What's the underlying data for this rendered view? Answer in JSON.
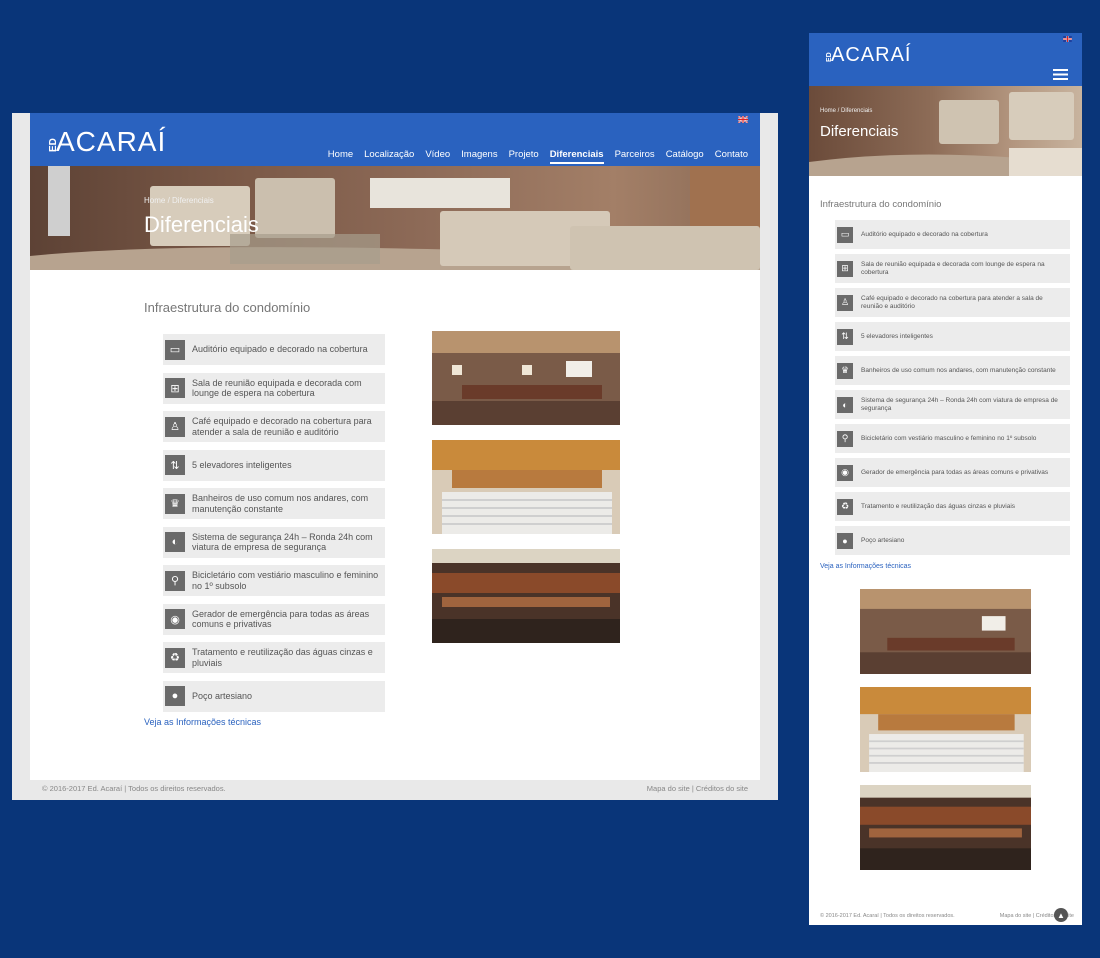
{
  "desktop": {
    "logo": {
      "prefix": "ED",
      "name": "ACARAÍ"
    },
    "nav": [
      "Home",
      "Localização",
      "Vídeo",
      "Imagens",
      "Projeto",
      "Diferenciais",
      "Parceiros",
      "Catálogo",
      "Contato"
    ],
    "active_nav": "Diferenciais",
    "breadcrumb": {
      "home": "Home",
      "current": "Diferenciais"
    },
    "hero_title": "Diferenciais",
    "section_title": "Infraestrutura do condomínio",
    "features": [
      {
        "icon": "auditorium-icon",
        "text": "Auditório equipado e decorado na cobertura"
      },
      {
        "icon": "meeting-room-icon",
        "text": "Sala de reunião equipada e decorada com lounge de espera na cobertura"
      },
      {
        "icon": "people-icon",
        "text": "Café equipado e decorado na cobertura para atender a sala de reunião e auditório"
      },
      {
        "icon": "elevator-icon",
        "text": "5 elevadores inteligentes"
      },
      {
        "icon": "restroom-icon",
        "text": "Banheiros de uso comum nos andares, com manutenção constante"
      },
      {
        "icon": "security-icon",
        "text": "Sistema de segurança 24h – Ronda 24h com viatura de empresa de segurança"
      },
      {
        "icon": "bicycle-icon",
        "text": "Bicicletário com vestiário masculino e feminino no 1º subsolo"
      },
      {
        "icon": "generator-icon",
        "text": "Gerador de emergência para todas as áreas comuns e privativas"
      },
      {
        "icon": "recycle-icon",
        "text": "Tratamento e reutilização das águas cinzas e pluviais"
      },
      {
        "icon": "water-drop-icon",
        "text": "Poço artesiano"
      }
    ],
    "more_link": "Veja as Informações técnicas",
    "footer": {
      "copyright": "© 2016-2017 Ed. Acaraí | Todos os direitos reservados.",
      "sitemap": "Mapa do site",
      "credits": "Créditos do site",
      "divider": "|"
    }
  },
  "mobile": {
    "logo": {
      "prefix": "ED",
      "name": "ACARAÍ"
    },
    "breadcrumb": {
      "home": "Home",
      "current": "Diferenciais"
    },
    "hero_title": "Diferenciais",
    "section_title": "Infraestrutura do condomínio",
    "more_link": "Veja as Informações técnicas",
    "footer": {
      "copyright": "© 2016-2017 Ed. Acaraí | Todos os direitos reservados.",
      "sitemap": "Mapa do site",
      "credits": "Créditos do site",
      "divider": "|"
    }
  },
  "colors": {
    "background": "#093579",
    "brand_blue": "#2a62bf",
    "feature_bg": "#ececec",
    "icon_bg": "#6a6a6a"
  }
}
